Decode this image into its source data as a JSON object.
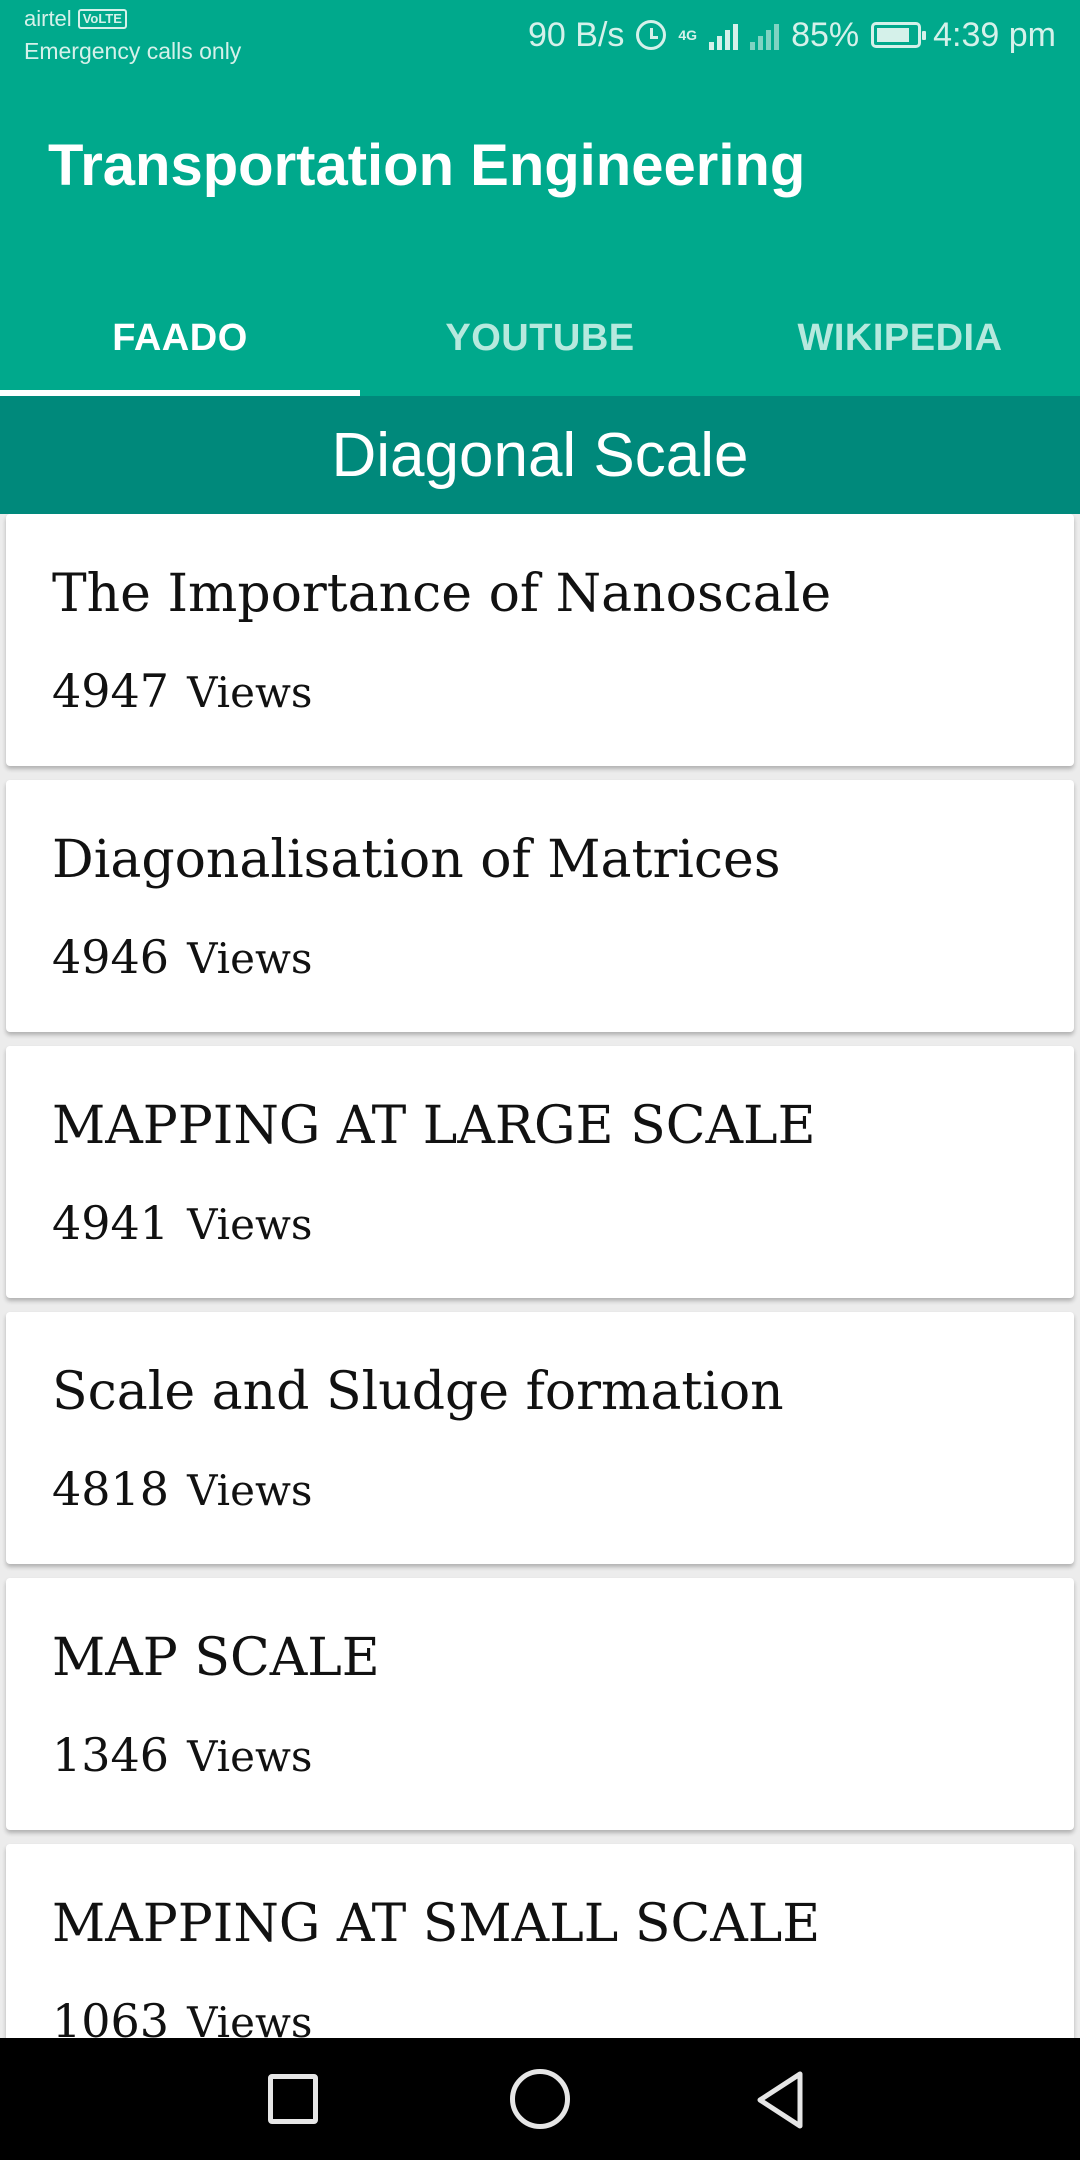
{
  "status_bar": {
    "carrier": "airtel",
    "volte": "VoLTE",
    "emergency": "Emergency calls only",
    "speed": "90 B/s",
    "network": "4G",
    "battery_percent": "85%",
    "battery_level": 0.85,
    "time": "4:39 pm"
  },
  "app_bar": {
    "title": "Transportation Engineering",
    "tabs": [
      {
        "label": "FAADO",
        "active": true
      },
      {
        "label": "YOUTUBE",
        "active": false
      },
      {
        "label": "WIKIPEDIA",
        "active": false
      }
    ]
  },
  "section_header": "Diagonal Scale",
  "items": [
    {
      "title": "The Importance of Nanoscale",
      "views": "4947",
      "views_label": "Views"
    },
    {
      "title": "Diagonalisation of Matrices",
      "views": "4946",
      "views_label": "Views"
    },
    {
      "title": "MAPPING AT LARGE SCALE",
      "views": "4941",
      "views_label": "Views"
    },
    {
      "title": "Scale and Sludge formation",
      "views": "4818",
      "views_label": "Views"
    },
    {
      "title": "MAP SCALE",
      "views": "1346",
      "views_label": "Views"
    },
    {
      "title": "MAPPING AT SMALL SCALE",
      "views": "1063",
      "views_label": "Views"
    }
  ],
  "nav_bar": {
    "recents_icon": "square-icon",
    "home_icon": "circle-icon",
    "back_icon": "triangle-back-icon"
  },
  "colors": {
    "primary": "#00a98c",
    "section": "#00897b",
    "background": "#ececec"
  }
}
